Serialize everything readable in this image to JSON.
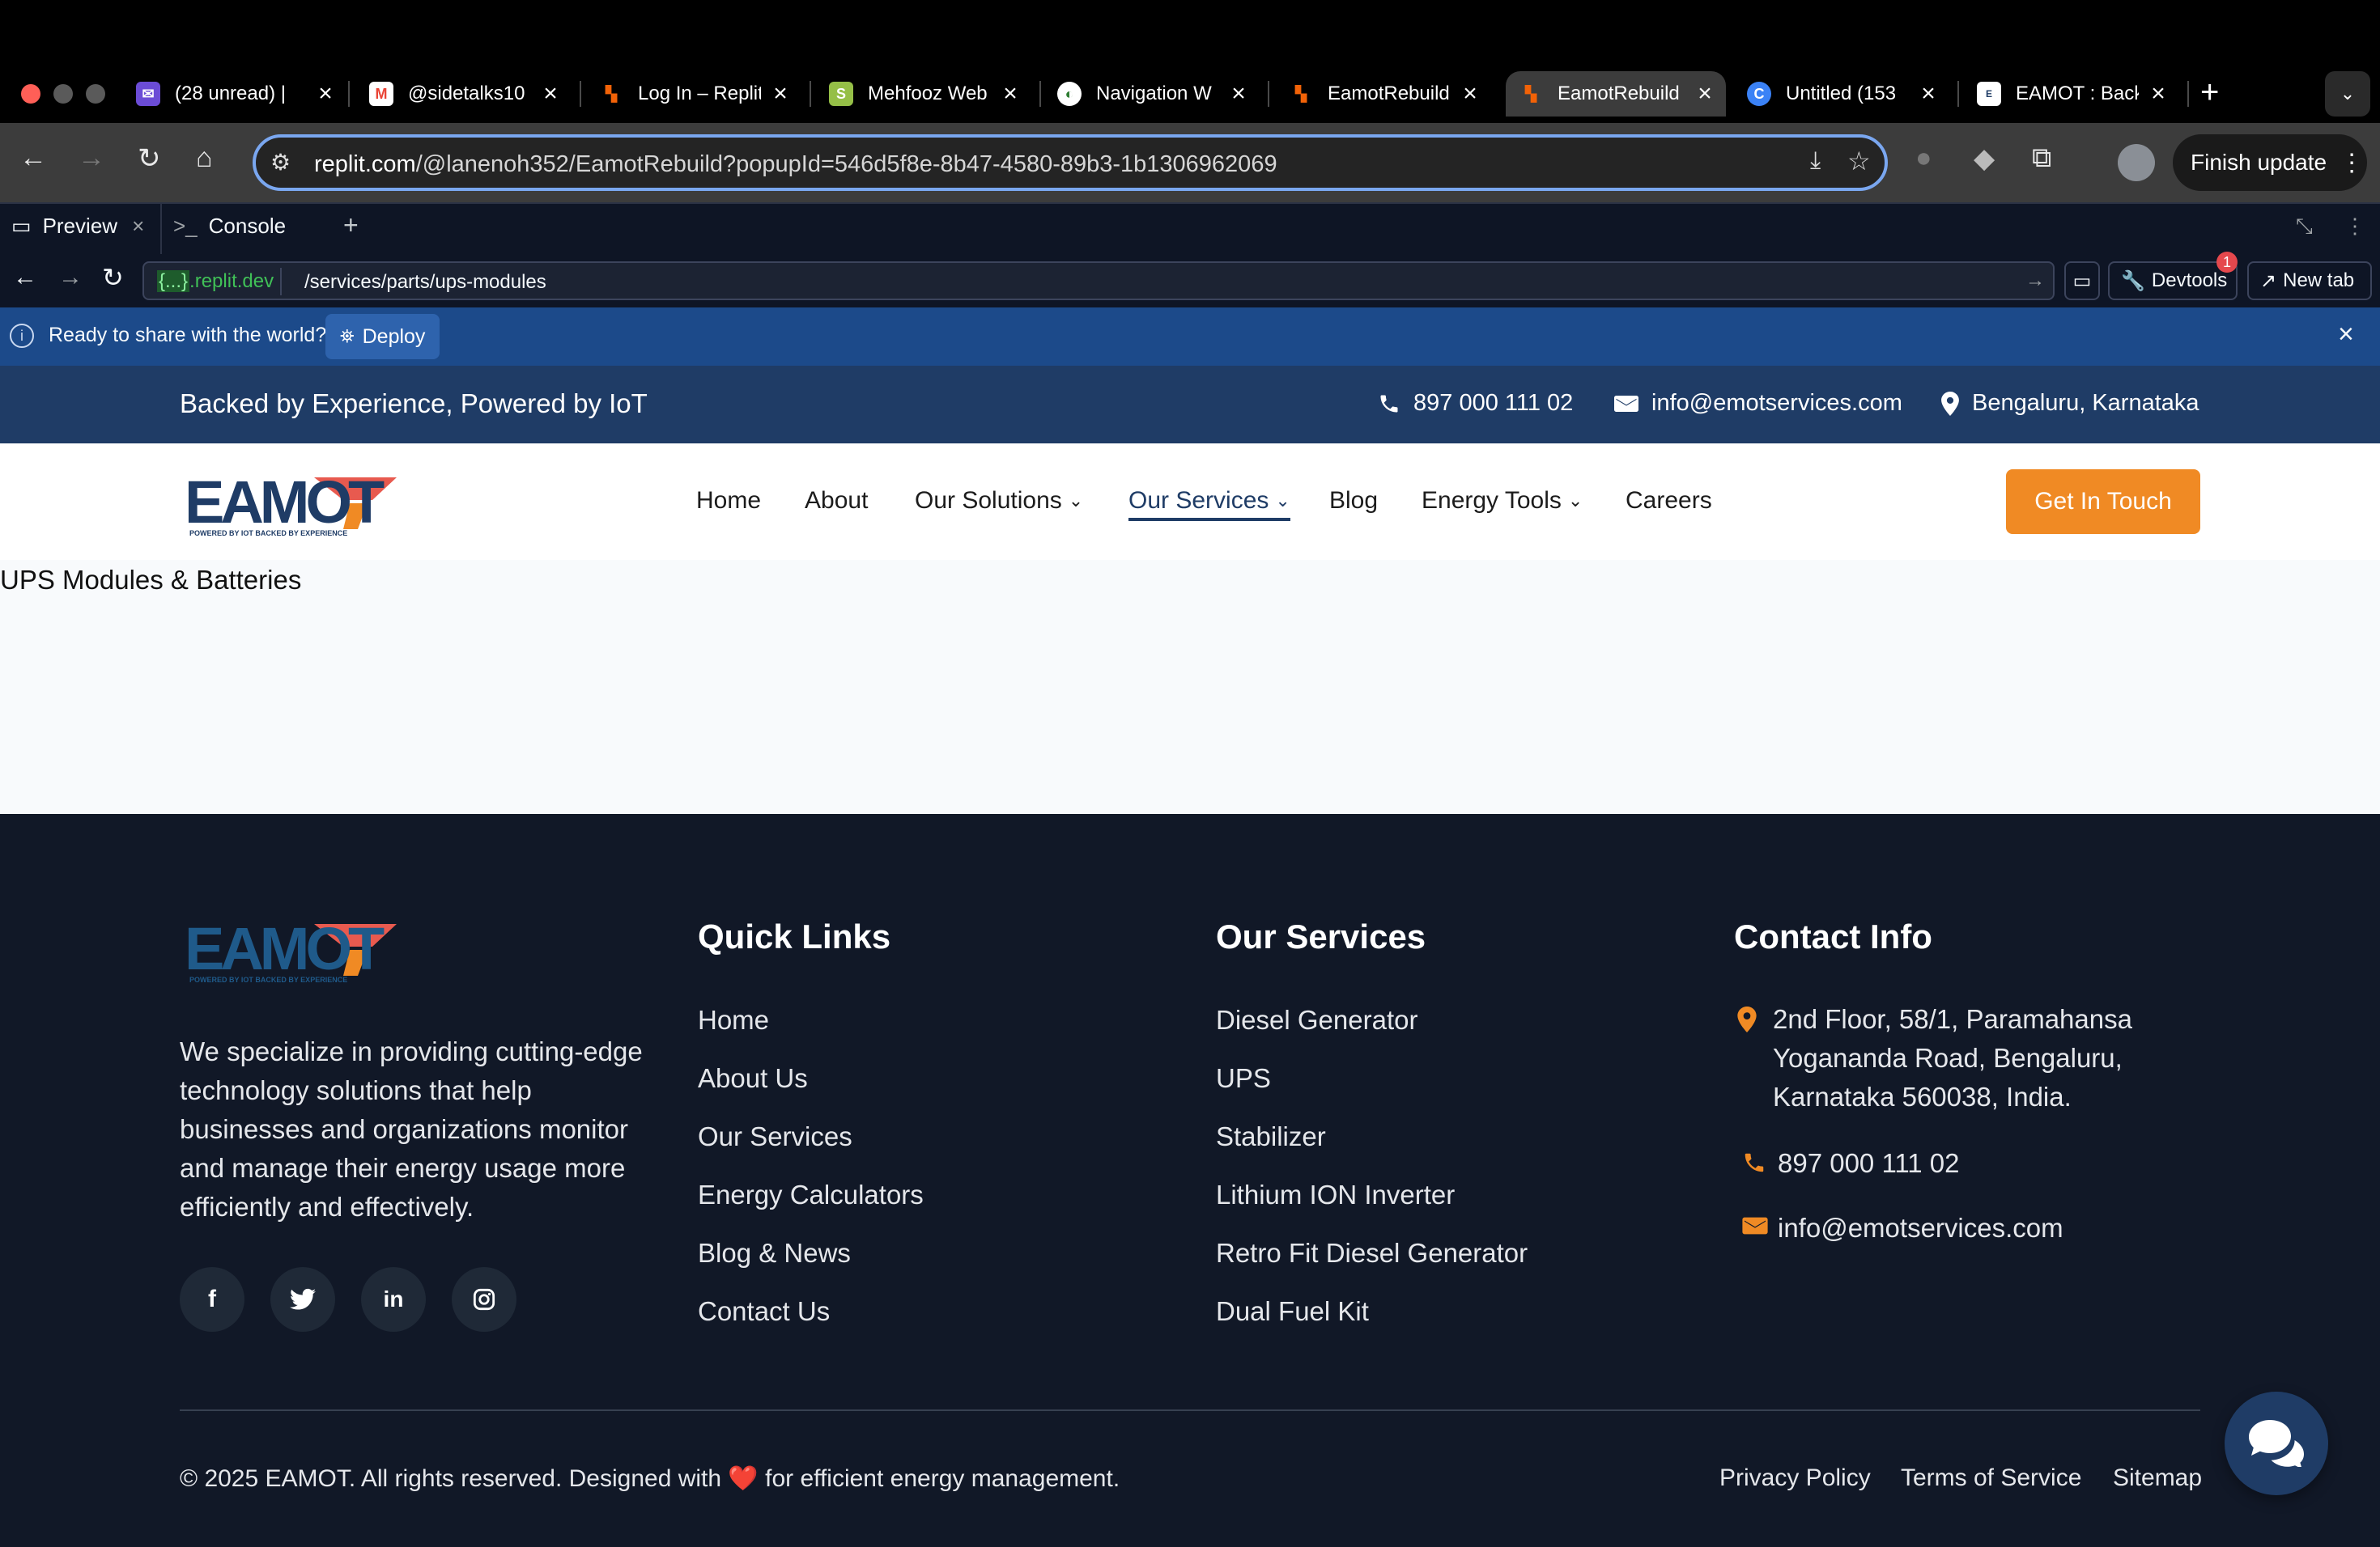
{
  "browser": {
    "tabs": [
      {
        "title": "(28 unread) | ",
        "favicon": "yahoo-mail-icon",
        "active": false
      },
      {
        "title": "@sidetalks10",
        "favicon": "gmail-icon",
        "active": false
      },
      {
        "title": "Log In – Replit",
        "favicon": "replit-icon",
        "active": false
      },
      {
        "title": "Mehfooz Web",
        "favicon": "shopify-icon",
        "active": false
      },
      {
        "title": "Navigation W",
        "favicon": "globe-icon",
        "active": false
      },
      {
        "title": "EamotRebuild",
        "favicon": "replit-icon",
        "active": false
      },
      {
        "title": "EamotRebuild",
        "favicon": "replit-icon",
        "active": true
      },
      {
        "title": "Untitled (153",
        "favicon": "canva-icon",
        "active": false
      },
      {
        "title": "EAMOT : Back",
        "favicon": "eamot-icon",
        "active": false
      }
    ],
    "new_tab_label": "+",
    "url_host": "replit.com",
    "url_rest": "/@lanenoh352/EamotRebuild?popupId=546d5f8e-8b47-4580-89b3-1b1306962069",
    "finish_update_label": "Finish update"
  },
  "replit": {
    "tabs": [
      {
        "label": "Preview",
        "close": "×"
      },
      {
        "label": "Console"
      }
    ],
    "add_tab": "+",
    "url_domain_braces": "{...}",
    "url_domain_rest": ".replit.dev",
    "url_path": "/services/parts/ups-modules",
    "devtools_label": "Devtools",
    "devtools_badge": "1",
    "new_tab_label": "New tab",
    "deploy_message": "Ready to share with the world?",
    "deploy_label": "Deploy"
  },
  "site": {
    "colors": {
      "primary": "#1f3c66",
      "accent": "#f08a24",
      "footer_bg": "#111827"
    },
    "topbar": {
      "tagline": "Backed by Experience, Powered by IoT",
      "phone": "897 000 111 02",
      "email": "info@emotservices.com",
      "location": "Bengaluru, Karnataka"
    },
    "logo": {
      "text": "EAMOT",
      "tagline": "POWERED BY IOT BACKED BY EXPERIENCE"
    },
    "nav": [
      {
        "label": "Home"
      },
      {
        "label": "About"
      },
      {
        "label": "Our Solutions",
        "dropdown": true
      },
      {
        "label": "Our Services",
        "dropdown": true,
        "active": true
      },
      {
        "label": "Blog"
      },
      {
        "label": "Energy Tools",
        "dropdown": true
      },
      {
        "label": "Careers"
      }
    ],
    "cta": "Get In Touch",
    "page_heading": "UPS Modules & Batteries",
    "footer": {
      "description": "We specialize in providing cutting-edge technology solutions that help businesses and organizations monitor and manage their energy usage more efficiently and effectively.",
      "social": [
        "facebook-icon",
        "twitter-icon",
        "linkedin-icon",
        "instagram-icon"
      ],
      "quick_links_title": "Quick Links",
      "quick_links": [
        "Home",
        "About Us",
        "Our Services",
        "Energy Calculators",
        "Blog & News",
        "Contact Us"
      ],
      "services_title": "Our Services",
      "services": [
        "Diesel Generator",
        "UPS",
        "Stabilizer",
        "Lithium ION Inverter",
        "Retro Fit Diesel Generator",
        "Dual Fuel Kit"
      ],
      "contact_title": "Contact Info",
      "address_lines": [
        "2nd Floor, 58/1, Paramahansa",
        "Yogananda Road, Bengaluru,",
        "Karnataka 560038, India."
      ],
      "phone": "897 000 111 02",
      "email": "info@emotservices.com",
      "copyright_prefix": "© 2025 EAMOT. All rights reserved. Designed with",
      "copyright_heart": "❤️",
      "copyright_suffix": "for efficient energy management.",
      "legal": [
        "Privacy Policy",
        "Terms of Service",
        "Sitemap"
      ]
    }
  }
}
